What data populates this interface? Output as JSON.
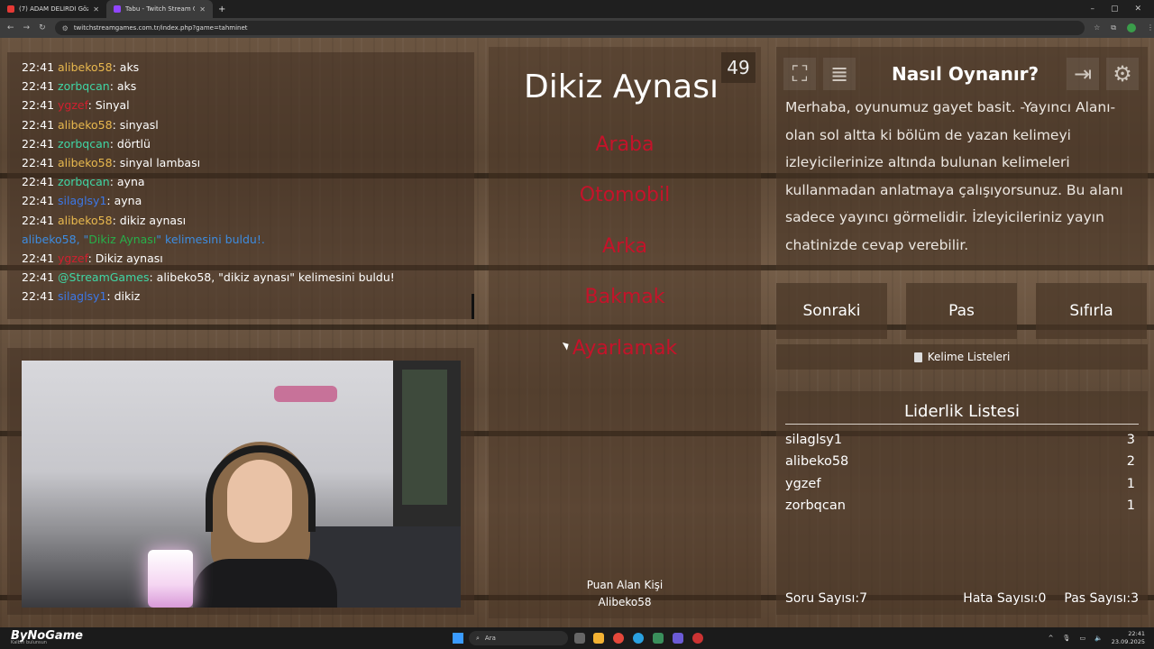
{
  "browser": {
    "tabs": [
      {
        "title": "(7) ADAM DELİRDİ Gözümüzü",
        "active": false
      },
      {
        "title": "Tabu - Twitch Stream Game",
        "active": true
      }
    ],
    "url": "twitchstreamgames.com.tr/index.php?game=tahminet",
    "window_controls": [
      "–",
      "▢",
      "✕"
    ]
  },
  "chat": {
    "messages": [
      {
        "time": "22:41",
        "user": "alibeko58",
        "color": "ali",
        "text": ": aks"
      },
      {
        "time": "22:41",
        "user": "zorbqcan",
        "color": "zorb",
        "text": ": aks"
      },
      {
        "time": "22:41",
        "user": "ygzef",
        "color": "yg",
        "text": ": Sinyal"
      },
      {
        "time": "22:41",
        "user": "alibeko58",
        "color": "ali",
        "text": ": sinyasl"
      },
      {
        "time": "22:41",
        "user": "zorbqcan",
        "color": "zorb",
        "text": ": dörtlü"
      },
      {
        "time": "22:41",
        "user": "alibeko58",
        "color": "ali",
        "text": ": sinyal lambası"
      },
      {
        "time": "22:41",
        "user": "zorbqcan",
        "color": "zorb",
        "text": ": ayna"
      },
      {
        "time": "22:41",
        "user": "silaglsy1",
        "color": "sila",
        "text": ": ayna"
      },
      {
        "time": "22:41",
        "user": "alibeko58",
        "color": "ali",
        "text": ": dikiz aynası"
      },
      {
        "time": "",
        "system": true,
        "before": "alibeko58, \"",
        "highlight": "Dikiz Aynası",
        "after": "\" kelimesini buldu!."
      },
      {
        "time": "22:41",
        "user": "ygzef",
        "color": "yg",
        "text": ": Dikiz aynası"
      },
      {
        "time": "22:41",
        "user": "@StreamGames",
        "color": "sg",
        "text": ": alibeko58, \"dikiz aynası\" kelimesini buldu!"
      },
      {
        "time": "22:41",
        "user": "silaglsy1",
        "color": "sila",
        "text": ": dikiz"
      }
    ]
  },
  "game": {
    "timer": "49",
    "word": "Dikiz Aynası",
    "forbidden": [
      "Araba",
      "Otomobil",
      "Arka",
      "Bakmak",
      "Ayarlamak"
    ],
    "scorer_label": "Puan Alan Kişi",
    "scorer_name": "Alibeko58"
  },
  "how_to": {
    "title": "Nasıl Oynanır?",
    "text": "Merhaba, oyunumuz gayet basit. -Yayıncı Alanı- olan sol altta ki bölüm de yazan kelimeyi izleyicilerinize altında bulunan kelimeleri kullanmadan anlatmaya çalışıyorsunuz. Bu alanı sadece yayıncı görmelidir. İzleyicileriniz yayın chatinizde cevap verebilir."
  },
  "actions": {
    "next": "Sonraki",
    "pass": "Pas",
    "reset": "Sıfırla",
    "word_lists": "Kelime Listeleri"
  },
  "leaderboard": {
    "title": "Liderlik Listesi",
    "rows": [
      {
        "name": "silaglsy1",
        "score": "3"
      },
      {
        "name": "alibeko58",
        "score": "2"
      },
      {
        "name": "ygzef",
        "score": "1"
      },
      {
        "name": "zorbqcan",
        "score": "1"
      }
    ],
    "stats": {
      "questions_label": "Soru Sayısı:",
      "questions_value": "7",
      "errors_label": "Hata Sayısı:",
      "errors_value": "0",
      "passes_label": "Pas Sayısı:",
      "passes_value": "3"
    }
  },
  "taskbar": {
    "brand": "ByNoGame",
    "brand_sub": "Kalbin bulunsun",
    "search_placeholder": "Ara",
    "time": "22:41",
    "date": "23.09.2025"
  },
  "colors": {
    "forbidden": "#c4132a",
    "user_ali": "#e8b84e",
    "user_zorb": "#3fd6a5",
    "user_yg": "#d21f2f",
    "user_sila": "#3c77e6"
  }
}
